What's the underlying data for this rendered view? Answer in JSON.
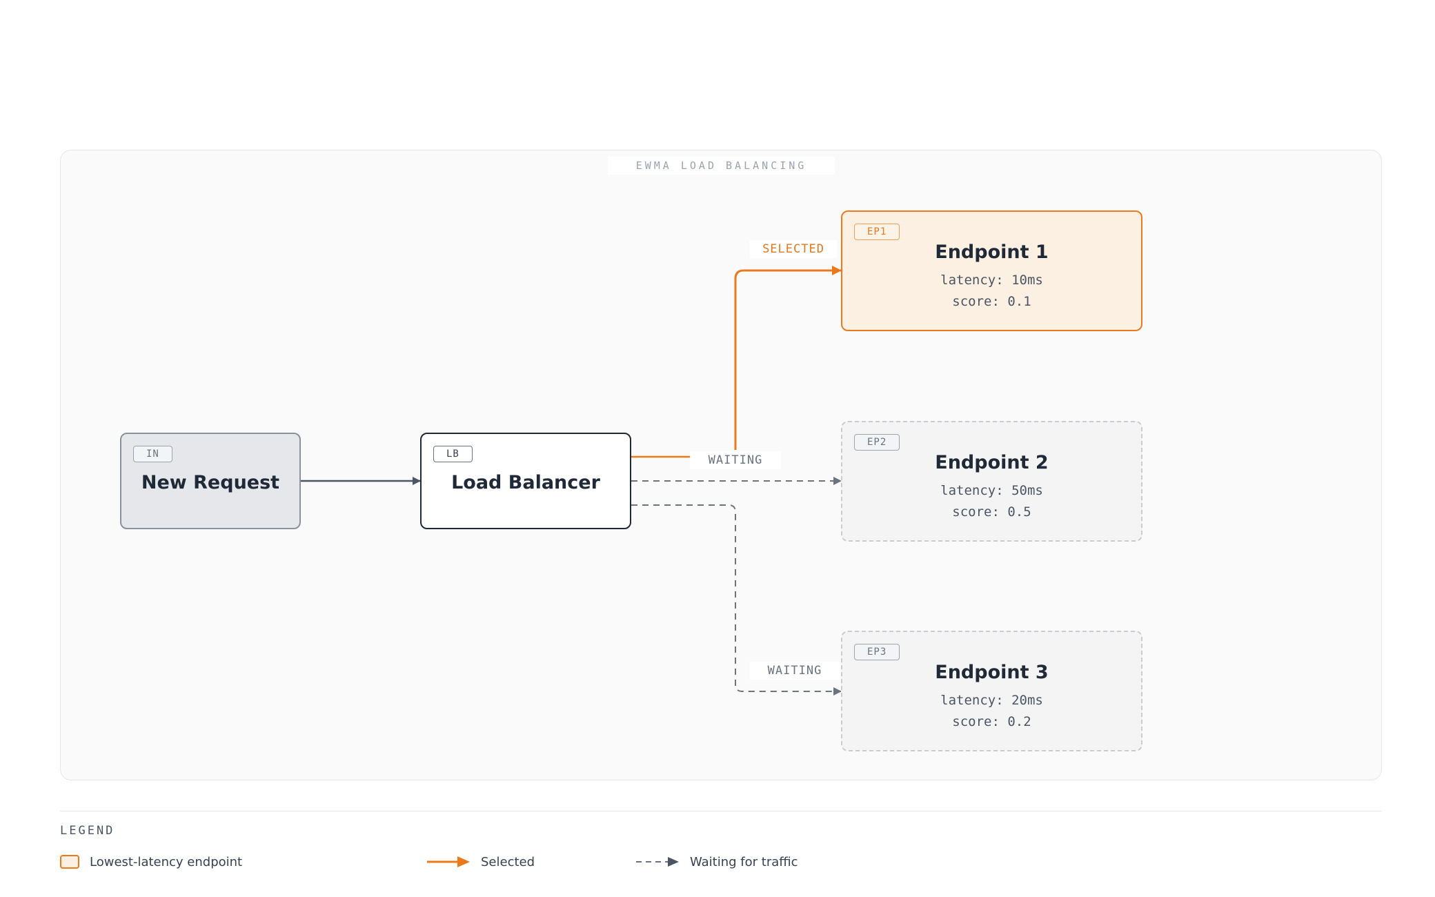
{
  "diagram": {
    "frame_title": "EWMA LOAD BALANCING",
    "nodes": {
      "input": {
        "tag": "IN",
        "title": "New Request"
      },
      "lb": {
        "tag": "LB",
        "title": "Load Balancer"
      },
      "ep1": {
        "tag": "EP1",
        "title": "Endpoint 1",
        "latency": "latency: 10ms",
        "score": "score: 0.1",
        "state": "selected"
      },
      "ep2": {
        "tag": "EP2",
        "title": "Endpoint 2",
        "latency": "latency: 50ms",
        "score": "score: 0.5",
        "state": "waiting"
      },
      "ep3": {
        "tag": "EP3",
        "title": "Endpoint 3",
        "latency": "latency: 20ms",
        "score": "score: 0.2",
        "state": "waiting"
      }
    },
    "edges": {
      "to_ep1": "SELECTED",
      "to_ep2": "WAITING",
      "to_ep3": "WAITING"
    },
    "colors": {
      "selected": "#ec7a1c",
      "waiting": "#6b7280",
      "flow": "#4b5563"
    }
  },
  "legend": {
    "title": "LEGEND",
    "items": [
      {
        "label": "Lowest-latency endpoint"
      },
      {
        "label": "Selected"
      },
      {
        "label": "Waiting for traffic"
      }
    ]
  }
}
